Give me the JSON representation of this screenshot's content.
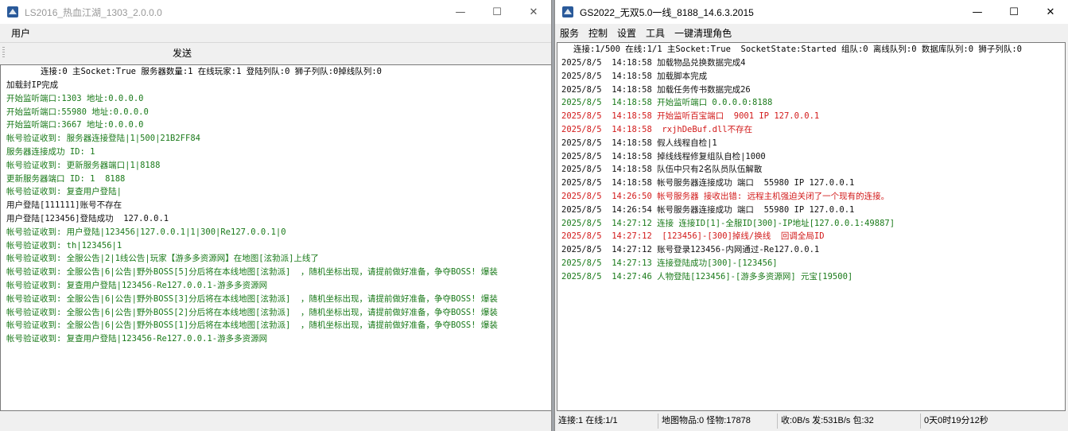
{
  "win1": {
    "title": "LS2016_热血江湖_1303_2.0.0.0",
    "controls": {
      "minimize": "—",
      "maximize": "☐",
      "close": "✕"
    },
    "menu": [
      "用户"
    ],
    "send_label": "发送",
    "status_line": "连接:0 主Socket:True 服务器数量:1 在线玩家:1 登陆列队:0 狮子列队:0掉线队列:0",
    "lines": [
      {
        "text": "加载封IP完成",
        "color": "black"
      },
      {
        "text": "开始监听端口:1303 地址:0.0.0.0",
        "color": "green"
      },
      {
        "text": "开始监听端口:55980 地址:0.0.0.0",
        "color": "green"
      },
      {
        "text": "开始监听端口:3667 地址:0.0.0.0",
        "color": "green"
      },
      {
        "text": "帐号验证收到: 服务器连接登陆|1|500|21B2FF84",
        "color": "green"
      },
      {
        "text": "服务器连接成功 ID: 1",
        "color": "green"
      },
      {
        "text": "帐号验证收到: 更新服务器端口|1|8188",
        "color": "green"
      },
      {
        "text": "更新服务器端口 ID: 1  8188",
        "color": "green"
      },
      {
        "text": "帐号验证收到: 复查用户登陆|",
        "color": "green"
      },
      {
        "text": "用户登陆[111111]账号不存在",
        "color": "black"
      },
      {
        "text": "用户登陆[123456]登陆成功  127.0.0.1",
        "color": "black"
      },
      {
        "text": "帐号验证收到: 用户登陆|123456|127.0.0.1|1|300|Re127.0.0.1|0",
        "color": "green"
      },
      {
        "text": "帐号验证收到: th|123456|1",
        "color": "green"
      },
      {
        "text": "帐号验证收到: 全服公告|2|1线公告|玩家【游多多资源网】在地图[泫勃派]上线了",
        "color": "green"
      },
      {
        "text": "帐号验证收到: 全服公告|6|公告|野外BOSS[5]分后将在本线地图[泫勃派]  ，随机坐标出现，请提前做好准备，争夺BOSS! 爆装",
        "color": "green"
      },
      {
        "text": "帐号验证收到: 复查用户登陆|123456-Re127.0.0.1-游多多资源网",
        "color": "green"
      },
      {
        "text": "帐号验证收到: 全服公告|6|公告|野外BOSS[3]分后将在本线地图[泫勃派]  ，随机坐标出现，请提前做好准备，争夺BOSS! 爆装",
        "color": "green"
      },
      {
        "text": "帐号验证收到: 全服公告|6|公告|野外BOSS[2]分后将在本线地图[泫勃派]  ，随机坐标出现，请提前做好准备，争夺BOSS! 爆装",
        "color": "green"
      },
      {
        "text": "帐号验证收到: 全服公告|6|公告|野外BOSS[1]分后将在本线地图[泫勃派]  ，随机坐标出现，请提前做好准备，争夺BOSS! 爆装",
        "color": "green"
      },
      {
        "text": "帐号验证收到: 复查用户登陆|123456-Re127.0.0.1-游多多资源网",
        "color": "green"
      }
    ]
  },
  "win2": {
    "title": "GS2022_无双5.0一线_8188_14.6.3.2015",
    "controls": {
      "minimize": "—",
      "maximize": "☐",
      "close": "✕"
    },
    "menu": [
      "服务",
      "控制",
      "设置",
      "工具",
      "一键清理角色"
    ],
    "status_line": "连接:1/500 在线:1/1 主Socket:True  SocketState:Started 组队:0 离线队列:0 数据库队列:0 狮子列队:0",
    "lines": [
      {
        "text": "2025/8/5  14:18:58 加载物品兑换数据完成4",
        "color": "black"
      },
      {
        "text": "2025/8/5  14:18:58 加载脚本完成",
        "color": "black"
      },
      {
        "text": "2025/8/5  14:18:58 加载任务传书数据完成26",
        "color": "black"
      },
      {
        "text": "2025/8/5  14:18:58 开始监听端口 0.0.0.0:8188",
        "color": "green"
      },
      {
        "text": "2025/8/5  14:18:58 开始监听百宝端口  9001 IP 127.0.0.1",
        "color": "red"
      },
      {
        "text": "2025/8/5  14:18:58  rxjhDeBuf.dll不存在",
        "color": "red"
      },
      {
        "text": "2025/8/5  14:18:58 假人线程自检|1",
        "color": "black"
      },
      {
        "text": "2025/8/5  14:18:58 掉线线程修复组队自检|1000",
        "color": "black"
      },
      {
        "text": "2025/8/5  14:18:58 队伍中只有2名队员队伍解散",
        "color": "black"
      },
      {
        "text": "2025/8/5  14:18:58 帐号服务器连接成功 端口  55980 IP 127.0.0.1",
        "color": "black"
      },
      {
        "text": "2025/8/5  14:26:50 帐号服务器 接收出错: 远程主机强迫关闭了一个现有的连接。",
        "color": "red"
      },
      {
        "text": "2025/8/5  14:26:54 帐号服务器连接成功 端口  55980 IP 127.0.0.1",
        "color": "black"
      },
      {
        "text": "2025/8/5  14:27:12 连接 连接ID[1]-全服ID[300]-IP地址[127.0.0.1:49887]",
        "color": "green"
      },
      {
        "text": "2025/8/5  14:27:12  [123456]-[300]掉线/换线  回调全局ID",
        "color": "red"
      },
      {
        "text": "2025/8/5  14:27:12 账号登录123456-内网通过-Re127.0.0.1",
        "color": "black"
      },
      {
        "text": "2025/8/5  14:27:13 连接登陆成功[300]-[123456]",
        "color": "green"
      },
      {
        "text": "2025/8/5  14:27:46 人物登陆[123456]-[游多多资源网] 元宝[19500]",
        "color": "green"
      }
    ],
    "statusbar": [
      "连接:1 在线:1/1",
      "地图物品:0 怪物:17878",
      "收:0B/s 发:531B/s 包:32",
      "0天0时19分12秒"
    ]
  },
  "colors": {
    "black": "#111111",
    "green": "#1a7a1a",
    "red": "#d21a1a"
  }
}
